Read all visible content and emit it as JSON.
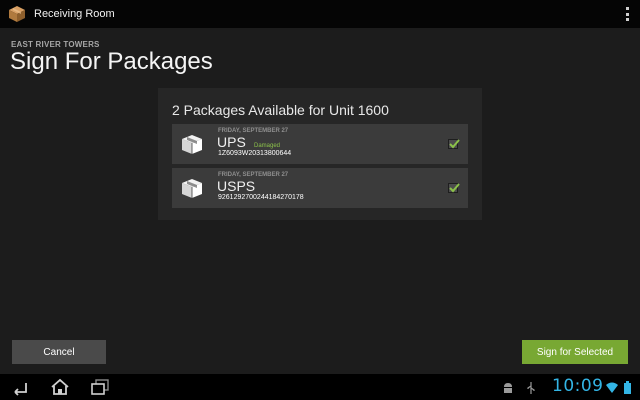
{
  "app": {
    "title": "Receiving Room",
    "icon": "package-box-icon"
  },
  "header": {
    "building": "EAST RIVER TOWERS",
    "title": "Sign For Packages"
  },
  "panel": {
    "title": "2 Packages Available for Unit 1600",
    "packages": [
      {
        "date": "FRIDAY, SEPTEMBER 27",
        "carrier": "UPS",
        "status": "Damaged",
        "tracking": "1Z6093W20313800644",
        "checked": true
      },
      {
        "date": "FRIDAY, SEPTEMBER 27",
        "carrier": "USPS",
        "status": "",
        "tracking": "9261292700244184270178",
        "checked": true
      }
    ]
  },
  "buttons": {
    "cancel": "Cancel",
    "sign": "Sign for Selected"
  },
  "system_bar": {
    "time": "10:09"
  },
  "colors": {
    "accent": "#78a833",
    "status_damaged": "#8cc24a",
    "clock": "#33b5e5",
    "checkmark": "#8cc24a"
  }
}
